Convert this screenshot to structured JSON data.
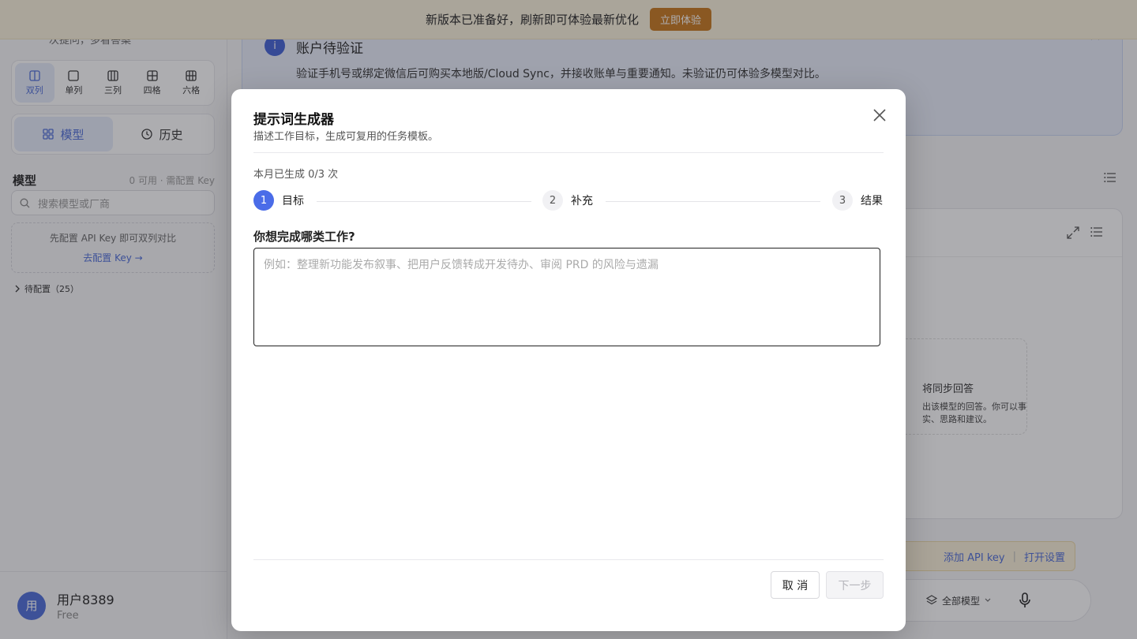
{
  "banner": {
    "text": "新版本已准备好，刷新即可体验最新优化",
    "button": "立即体验"
  },
  "sidebar": {
    "cut_text": "次提问，多看答案",
    "layouts": [
      {
        "label": "双列",
        "icon": "two-column-icon",
        "active": true
      },
      {
        "label": "单列",
        "icon": "single-column-icon",
        "active": false
      },
      {
        "label": "三列",
        "icon": "three-column-icon",
        "active": false
      },
      {
        "label": "四格",
        "icon": "four-grid-icon",
        "active": false
      },
      {
        "label": "六格",
        "icon": "six-grid-icon",
        "active": false
      }
    ],
    "segments": {
      "models": "模型",
      "history": "历史"
    },
    "models_title": "模型",
    "models_meta": "0 可用 · 需配置 Key",
    "search_placeholder": "搜索模型或厂商",
    "apikey_hint": "先配置 API Key 即可双列对比",
    "apikey_link": "去配置 Key →",
    "pending_group": "待配置（25）",
    "user": {
      "avatar": "用",
      "name": "用户8389",
      "plan": "Free"
    }
  },
  "main": {
    "verify": {
      "icon": "i",
      "title": "账户待验证",
      "body": "验证手机号或绑定微信后可购买本地版/Cloud Sync，并接收账单与重要通知。未验证仍可体验多模型对比。"
    },
    "empty": {
      "line1": "将同步回答",
      "line2": "出该模型的回答。你可以事实、思路和建议。"
    },
    "keybar": {
      "add_key": "添加 API key",
      "separator": "|",
      "open_settings": "打开设置"
    },
    "model_picker": "全部模型"
  },
  "modal": {
    "title": "提示词生成器",
    "subtitle": "描述工作目标，生成可复用的任务模板。",
    "usage": "本月已生成 0/3 次",
    "steps": [
      {
        "num": "1",
        "label": "目标"
      },
      {
        "num": "2",
        "label": "补充"
      },
      {
        "num": "3",
        "label": "结果"
      }
    ],
    "question": "你想完成哪类工作?",
    "input_placeholder": "例如：整理新功能发布叙事、把用户反馈转成开发待办、审阅 PRD 的风险与遗漏",
    "input_value": "",
    "cancel": "取 消",
    "next": "下一步"
  }
}
